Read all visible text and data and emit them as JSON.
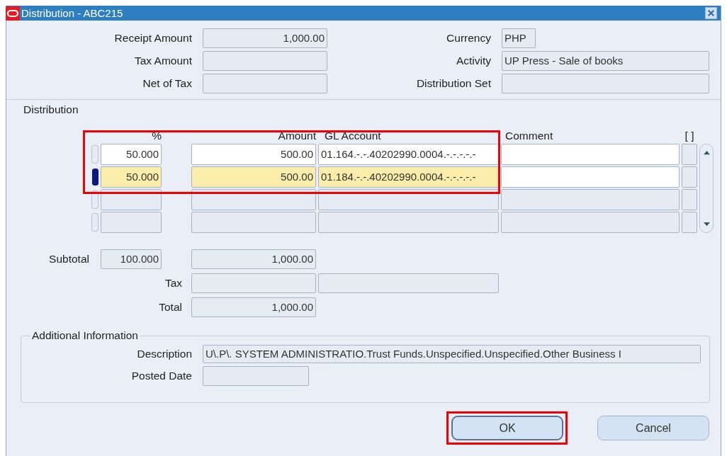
{
  "window": {
    "title": "Distribution - ABC215"
  },
  "header": {
    "left": [
      {
        "label": "Receipt Amount",
        "value": "1,000.00"
      },
      {
        "label": "Tax Amount"
      },
      {
        "label": "Net of Tax"
      }
    ],
    "right": [
      {
        "label": "Currency",
        "value": "PHP"
      },
      {
        "label": "Activity",
        "value": "UP Press - Sale of books"
      },
      {
        "label": "Distribution Set"
      }
    ]
  },
  "distribution": {
    "title": "Distribution",
    "highlighted": true,
    "columns": [
      "%",
      "Amount",
      "GL Account",
      "Comment",
      "[ ]"
    ],
    "rows": [
      {
        "percent": "50.000",
        "amount": "500.00",
        "gl_account": "01.164.-.-.40202990.0004.-.-.-.-.-",
        "selected": false,
        "enabled": true
      },
      {
        "percent": "50.000",
        "amount": "500.00",
        "gl_account": "01.184.-.-.40202990.0004.-.-.-.-.-",
        "selected": true,
        "enabled": true
      },
      {
        "selected": false,
        "enabled": false
      },
      {
        "selected": false,
        "enabled": false
      }
    ]
  },
  "totals": {
    "subtotal": {
      "label": "Subtotal",
      "percent": "100.000",
      "amount": "1,000.00"
    },
    "tax": {
      "label": "Tax"
    },
    "total": {
      "label": "Total",
      "amount": "1,000.00"
    }
  },
  "additional_information": {
    "title": "Additional Information",
    "fields": [
      {
        "label": "Description",
        "value": "U\\.P\\. SYSTEM ADMINISTRATIO.Trust Funds.Unspecified.Unspecified.Other Business I"
      },
      {
        "label": "Posted Date"
      }
    ]
  },
  "buttons": [
    {
      "label": "OK",
      "highlighted": true
    },
    {
      "label": "Cancel",
      "highlighted": false
    }
  ]
}
